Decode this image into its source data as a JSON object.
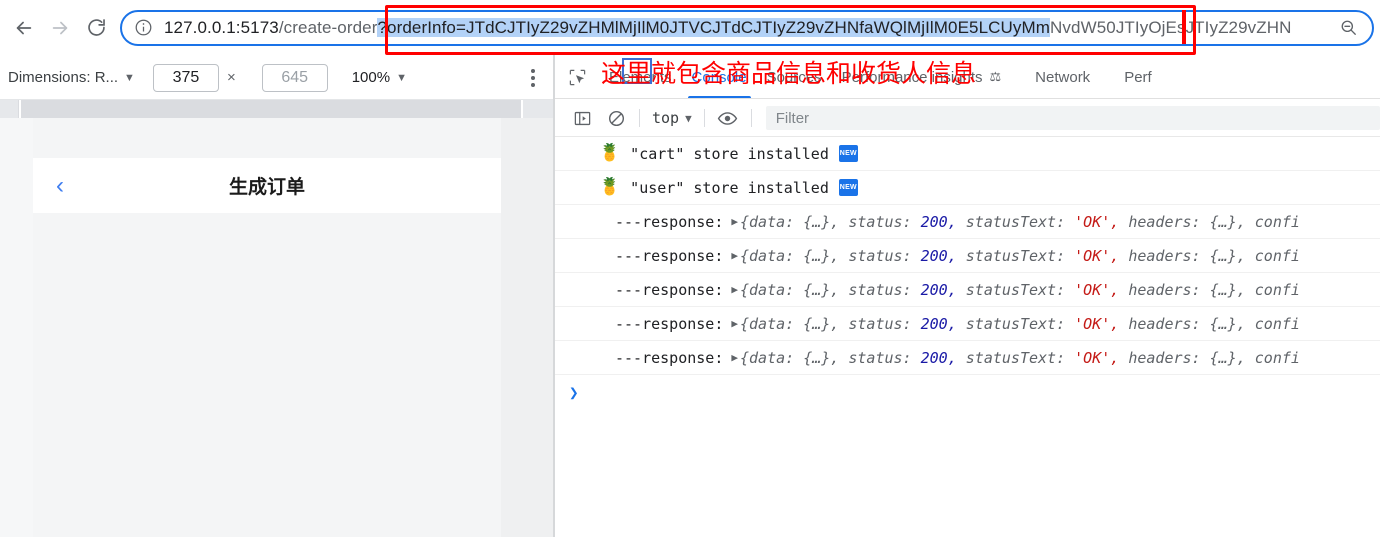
{
  "browser": {
    "nav": {
      "back_label": "Back",
      "forward_label": "Forward",
      "reload_label": "Reload"
    },
    "url": {
      "info_icon": "info-circle-icon",
      "host": "127.0.0.1:5173",
      "path": "/create-order",
      "selected": "?orderInfo=JTdCJTIyZ29vZHMlMjIlM0JTVCJTdCJTIyZ29vZHNfaWQlMjIlM0E5LCUyMm",
      "tail": "NvdW50JTIy",
      "tail2": "OjEsJTIyZ29vZHN",
      "full": "127.0.0.1:5173/create-order?orderInfo=JTdCJTIyZ29vZHMlMjIlM0JTVCJTdCJTIyZ29vZHNfaWQlMjIlM0E5LCUyMm NvdW50JTIyOjEsJTIyZ29vZHN",
      "zoom_icon": "zoom-out-icon"
    }
  },
  "device_toolbar": {
    "dimensions_label": "Dimensions: R...",
    "dropdown_icon": "chevron-down-icon",
    "width_value": "375",
    "times": "×",
    "height_placeholder": "645",
    "zoom_value": "100%",
    "more_icon": "kebab-menu-icon"
  },
  "device_page": {
    "back_icon": "chevron-left-icon",
    "title": "生成订单"
  },
  "devtools": {
    "inspect_icon": "inspect-element-icon",
    "tabs": [
      {
        "label": "Elements",
        "active": false,
        "badge": ""
      },
      {
        "label": "Console",
        "active": true,
        "badge": ""
      },
      {
        "label": "Sources",
        "active": false,
        "badge": ""
      },
      {
        "label": "Performance insights",
        "active": false,
        "badge": "flask-icon"
      },
      {
        "label": "Network",
        "active": false,
        "badge": ""
      },
      {
        "label": "Perf",
        "active": false,
        "badge": ""
      }
    ],
    "filterbar": {
      "sidebar_icon": "console-sidebar-icon",
      "clear_icon": "clear-console-icon",
      "context": "top",
      "context_caret": "chevron-down-icon",
      "eye_icon": "live-expression-eye-icon",
      "filter_placeholder": "Filter"
    },
    "console": {
      "store_rows": [
        {
          "icon": "pineapple-pinia-icon",
          "text": "\"cart\" store installed",
          "badge": "NEW"
        },
        {
          "icon": "pineapple-pinia-icon",
          "text": "\"user\" store installed",
          "badge": "NEW"
        }
      ],
      "response_rows": [
        {
          "label": "---response:",
          "expand_icon": "disclosure-triangle-icon",
          "open": "{data:",
          "data_val": "{…},",
          "status_key": "status:",
          "status_val": "200,",
          "status_text_key": "statusText:",
          "status_text_val": "'OK',",
          "headers_key": "headers:",
          "headers_val": "{…},",
          "config_key": "confi"
        },
        {
          "label": "---response:",
          "expand_icon": "disclosure-triangle-icon",
          "open": "{data:",
          "data_val": "{…},",
          "status_key": "status:",
          "status_val": "200,",
          "status_text_key": "statusText:",
          "status_text_val": "'OK',",
          "headers_key": "headers:",
          "headers_val": "{…},",
          "config_key": "confi"
        },
        {
          "label": "---response:",
          "expand_icon": "disclosure-triangle-icon",
          "open": "{data:",
          "data_val": "{…},",
          "status_key": "status:",
          "status_val": "200,",
          "status_text_key": "statusText:",
          "status_text_val": "'OK',",
          "headers_key": "headers:",
          "headers_val": "{…},",
          "config_key": "confi"
        },
        {
          "label": "---response:",
          "expand_icon": "disclosure-triangle-icon",
          "open": "{data:",
          "data_val": "{…},",
          "status_key": "status:",
          "status_val": "200,",
          "status_text_key": "statusText:",
          "status_text_val": "'OK',",
          "headers_key": "headers:",
          "headers_val": "{…},",
          "config_key": "confi"
        },
        {
          "label": "---response:",
          "expand_icon": "disclosure-triangle-icon",
          "open": "{data:",
          "data_val": "{…},",
          "status_key": "status:",
          "status_val": "200,",
          "status_text_key": "statusText:",
          "status_text_val": "'OK',",
          "headers_key": "headers:",
          "headers_val": "{…},",
          "config_key": "confi"
        }
      ],
      "prompt": "❯"
    }
  },
  "annotations": {
    "red_note": "这里就包含商品信息和收货人信息",
    "red_color": "#ff0000",
    "highlight_color": "#b3d2f7",
    "accent_color": "#1a73e8"
  }
}
